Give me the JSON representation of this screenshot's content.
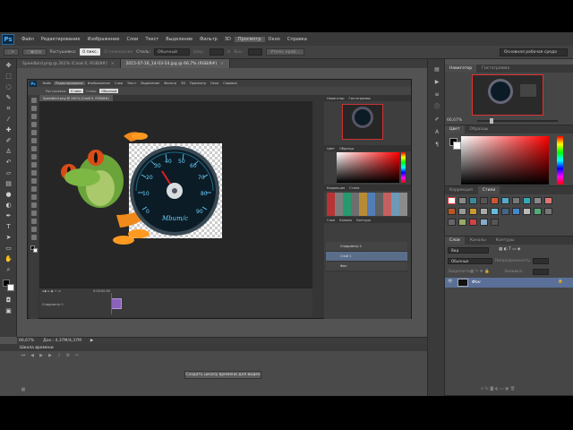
{
  "app": {
    "logo": "Ps",
    "menu": [
      "Файл",
      "Редактирование",
      "Изображение",
      "Слои",
      "Текст",
      "Выделение",
      "Фильтр",
      "3D",
      "Просмотр",
      "Окно",
      "Справка"
    ],
    "active_menu": "Просмотр"
  },
  "options": {
    "feather_label": "Растушевка:",
    "feather_value": "0 пикс.",
    "smooth_label": "Сглаживание",
    "style_label": "Стиль:",
    "style_value": "Обычный",
    "width_label": "Шир.:",
    "height_label": "Выс.:",
    "refine_button": "Уточн. край...",
    "workspace": "Основная рабочая среда"
  },
  "tabs": [
    {
      "label": "Speedbird.png @ 261% (Слой 0, RGB/8#)",
      "close": "×"
    },
    {
      "label": "2015-07-16_14-03-54.jpg @ 66,7% (RGB/8#)",
      "close": "×"
    }
  ],
  "inner": {
    "logo": "Ps",
    "menu": [
      "Файл",
      "Редактирование",
      "Изображение",
      "Слои",
      "Текст",
      "Выделение",
      "Фильтр",
      "3D",
      "Просмотр",
      "Окно",
      "Справка"
    ],
    "opt_feather_label": "Растушевка:",
    "opt_feather_value": "0 пикс",
    "opt_style_label": "Стиль:",
    "opt_style_value": "Обычный",
    "tab": "Speedbird.png @ 261% (Слой 0, RGB/8#)",
    "timeline_time": "0:00:00:00",
    "timeline_layer": "Спидометр 1",
    "panel_tabs_1": [
      "Навигатор",
      "Гистограмма"
    ],
    "panel_tabs_2": [
      "Цвет",
      "Образцы"
    ],
    "panel_tabs_3": [
      "Коррекция",
      "Стили"
    ],
    "panel_tabs_4": [
      "Слои",
      "Каналы",
      "Контуры"
    ],
    "layers": [
      "Спидометр 1",
      "Слой 1",
      "Фон"
    ]
  },
  "gauge": {
    "ticks": [
      "0",
      "10",
      "20",
      "30",
      "40",
      "50",
      "60",
      "70",
      "80",
      "90",
      "100"
    ],
    "unit": "Mbит/с"
  },
  "status": {
    "zoom": "66,67%",
    "doc": "Док.: 4,37М/4,37М",
    "arrow": "▶"
  },
  "timeline": {
    "title": "Шкала времени",
    "create_button": "Создать шкалу времени для видео"
  },
  "navigator": {
    "tabs": [
      "Навигатор",
      "Гистограмма"
    ],
    "zoom": "66,67%"
  },
  "color_panel": {
    "tabs": [
      "Цвет",
      "Образцы"
    ]
  },
  "styles_panel": {
    "tabs": [
      "Коррекция",
      "Стили"
    ]
  },
  "layers_panel": {
    "tabs": [
      "Слои",
      "Каналы",
      "Контуры"
    ],
    "filter": "Вид",
    "blend": "Обычные",
    "opacity_label": "Непрозрачность:",
    "fill_label": "Заливка:",
    "lock_label": "Закрепить:",
    "layer_name": "Фон"
  }
}
